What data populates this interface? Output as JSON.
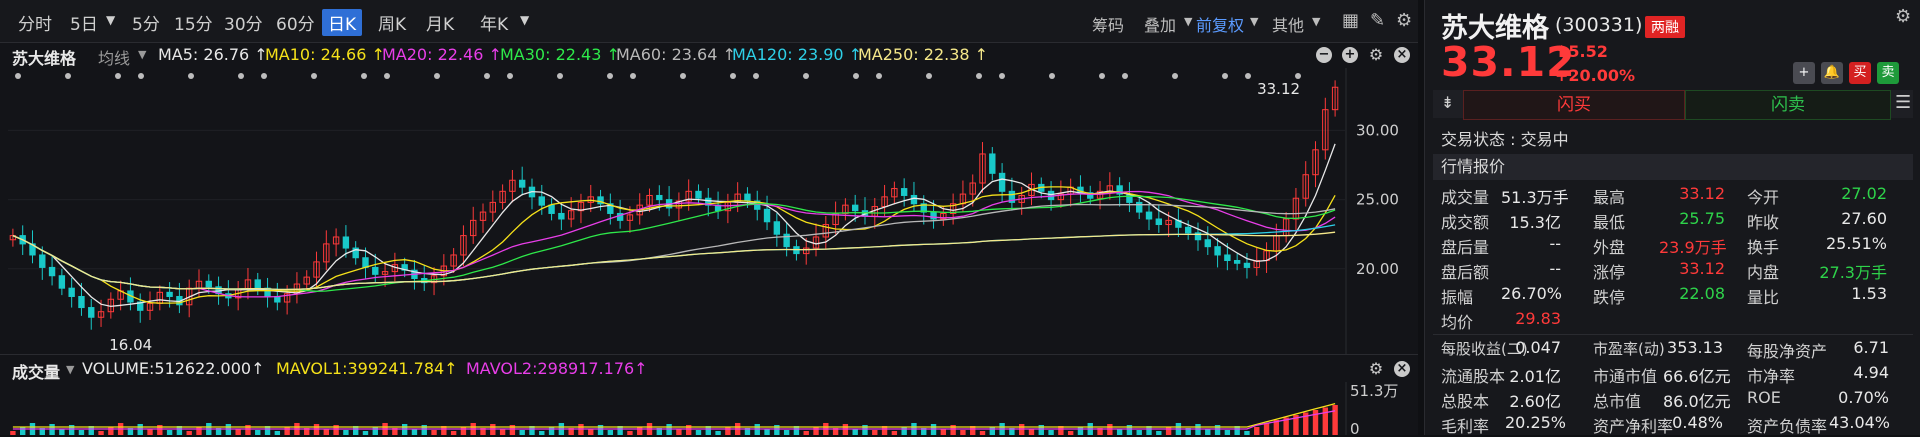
{
  "toolbar": {
    "periods": [
      "分时",
      "5日",
      "5分",
      "15分",
      "30分",
      "60分",
      "日K",
      "周K",
      "月K",
      "年K"
    ],
    "active_period": "日K",
    "right_items": [
      "筹码",
      "叠加",
      "前复权",
      "其他"
    ]
  },
  "ma": {
    "name": "苏大维格",
    "type": "均线",
    "items": [
      {
        "label": "MA5: 26.76 ↑",
        "color": "#e8e8e8"
      },
      {
        "label": "MA10: 24.66 ↑",
        "color": "#f5e11a"
      },
      {
        "label": "MA20: 22.46 ↑",
        "color": "#e83ee8"
      },
      {
        "label": "MA30: 22.43 ↑",
        "color": "#2ee84a"
      },
      {
        "label": "MA60: 23.64 ↑",
        "color": "#b8b8b8"
      },
      {
        "label": "MA120: 23.90 ↑",
        "color": "#2ed0e8"
      },
      {
        "label": "MA250: 22.38 ↑",
        "color": "#f5e88a"
      }
    ]
  },
  "chart_data": {
    "type": "candlestick",
    "y_ticks": [
      "30.00",
      "25.00",
      "20.00"
    ],
    "ylim": [
      15.0,
      33.5
    ],
    "high_label": "33.12",
    "low_label": "16.04",
    "closes": [
      22.4,
      21.8,
      21.0,
      20.1,
      19.5,
      18.6,
      18.0,
      17.2,
      16.5,
      16.9,
      17.8,
      18.4,
      17.6,
      17.0,
      17.5,
      18.3,
      18.0,
      17.4,
      18.6,
      19.1,
      18.7,
      18.2,
      17.9,
      18.5,
      19.2,
      18.6,
      18.0,
      17.6,
      18.2,
      18.9,
      19.4,
      20.5,
      21.8,
      22.3,
      21.5,
      20.8,
      20.1,
      19.6,
      19.8,
      20.3,
      19.9,
      19.3,
      19.0,
      19.5,
      20.2,
      21.0,
      22.4,
      23.5,
      24.1,
      24.8,
      25.6,
      26.4,
      25.9,
      25.2,
      24.6,
      24.0,
      23.6,
      24.2,
      24.8,
      25.2,
      24.7,
      24.0,
      23.5,
      23.9,
      24.6,
      25.3,
      25.0,
      24.4,
      24.9,
      25.6,
      25.1,
      24.6,
      24.2,
      24.8,
      25.4,
      24.9,
      24.3,
      23.4,
      22.5,
      21.6,
      21.1,
      21.5,
      22.3,
      23.2,
      24.0,
      24.6,
      24.2,
      23.8,
      24.5,
      25.2,
      25.8,
      25.3,
      24.7,
      24.1,
      23.6,
      24.0,
      24.7,
      25.4,
      26.2,
      28.3,
      26.9,
      25.6,
      24.8,
      25.3,
      26.1,
      25.6,
      25.0,
      25.4,
      25.9,
      25.5,
      25.1,
      25.6,
      26.0,
      25.4,
      24.8,
      24.1,
      23.6,
      23.2,
      23.5,
      23.0,
      22.6,
      22.1,
      21.6,
      21.0,
      20.6,
      20.4,
      20.1,
      20.6,
      21.3,
      22.4,
      23.6,
      25.1,
      26.8,
      28.6,
      31.5,
      33.12
    ],
    "volume_labels": [
      "51.3万",
      "0"
    ]
  },
  "volume": {
    "title": "成交量",
    "items": [
      {
        "label": "VOLUME:512622.000↑",
        "color": "#e8e8e8"
      },
      {
        "label": "MAVOL1:399241.784↑",
        "color": "#f5e11a"
      },
      {
        "label": "MAVOL2:298917.176↑",
        "color": "#e83ee8"
      }
    ]
  },
  "stock": {
    "name": "苏大维格",
    "code": "(300331)",
    "badge": "两融",
    "price": "33.12",
    "change": "5.52",
    "change_pct": "+20.00%",
    "btn_buy": "买",
    "btn_sell": "卖",
    "flash_buy": "闪买",
    "flash_sell": "闪卖",
    "trade_status": "交易状态 : 交易中",
    "quote_title": "行情报价"
  },
  "quote_rows": [
    [
      {
        "l": "成交量",
        "v": "51.3万手",
        "c": "white"
      },
      {
        "l": "最高",
        "v": "33.12",
        "c": "red"
      },
      {
        "l": "今开",
        "v": "27.02",
        "c": "green"
      }
    ],
    [
      {
        "l": "成交额",
        "v": "15.3亿",
        "c": "white"
      },
      {
        "l": "最低",
        "v": "25.75",
        "c": "green"
      },
      {
        "l": "昨收",
        "v": "27.60",
        "c": "white"
      }
    ],
    [
      {
        "l": "盘后量",
        "v": "--",
        "c": "white"
      },
      {
        "l": "外盘",
        "v": "23.9万手",
        "c": "red"
      },
      {
        "l": "换手",
        "v": "25.51%",
        "c": "white"
      }
    ],
    [
      {
        "l": "盘后额",
        "v": "--",
        "c": "white"
      },
      {
        "l": "涨停",
        "v": "33.12",
        "c": "red"
      },
      {
        "l": "内盘",
        "v": "27.3万手",
        "c": "green"
      }
    ],
    [
      {
        "l": "振幅",
        "v": "26.70%",
        "c": "white"
      },
      {
        "l": "跌停",
        "v": "22.08",
        "c": "green"
      },
      {
        "l": "量比",
        "v": "1.53",
        "c": "white"
      }
    ],
    [
      {
        "l": "均价",
        "v": "29.83",
        "c": "red"
      }
    ]
  ],
  "fin_rows": [
    [
      {
        "l": "每股收益(二)",
        "v": "0.047"
      },
      {
        "l": "市盈率(动)",
        "v": "353.13"
      },
      {
        "l": "每股净资产",
        "v": "6.71"
      }
    ],
    [
      {
        "l": "流通股本",
        "v": "2.01亿"
      },
      {
        "l": "市通市值",
        "v": "66.6亿元"
      },
      {
        "l": "市净率",
        "v": "4.94"
      }
    ],
    [
      {
        "l": "总股本",
        "v": "2.60亿"
      },
      {
        "l": "总市值",
        "v": "86.0亿元"
      },
      {
        "l": "ROE",
        "v": "0.70%"
      }
    ],
    [
      {
        "l": "毛利率",
        "v": "20.25%"
      },
      {
        "l": "资产净利率",
        "v": "0.48%"
      },
      {
        "l": "资产负债率",
        "v": "43.04%"
      }
    ]
  ]
}
